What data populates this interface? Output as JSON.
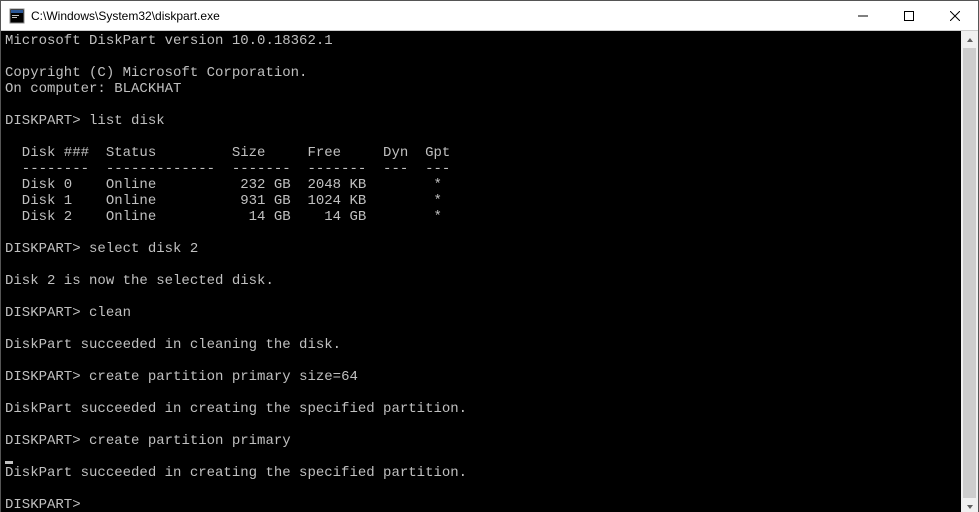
{
  "window": {
    "title": "C:\\Windows\\System32\\diskpart.exe"
  },
  "console": {
    "version_line": "Microsoft DiskPart version 10.0.18362.1",
    "copyright": "Copyright (C) Microsoft Corporation.",
    "computer_line": "On computer: BLACKHAT",
    "prompt": "DISKPART>",
    "cmd_list": "list disk",
    "header": "  Disk ###  Status         Size     Free     Dyn  Gpt",
    "divider": "  --------  -------------  -------  -------  ---  ---",
    "rows": {
      "r0": "  Disk 0    Online          232 GB  2048 KB        *",
      "r1": "  Disk 1    Online          931 GB  1024 KB        *",
      "r2": "  Disk 2    Online           14 GB    14 GB        *"
    },
    "cmd_select": "select disk 2",
    "msg_selected": "Disk 2 is now the selected disk.",
    "cmd_clean": "clean",
    "msg_clean": "DiskPart succeeded in cleaning the disk.",
    "cmd_create1": "create partition primary size=64",
    "msg_create1": "DiskPart succeeded in creating the specified partition.",
    "cmd_create2": "create partition primary",
    "msg_create2": "DiskPart succeeded in creating the specified partition."
  },
  "disks": [
    {
      "id": "Disk 0",
      "status": "Online",
      "size": "232 GB",
      "free": "2048 KB",
      "dyn": "",
      "gpt": "*"
    },
    {
      "id": "Disk 1",
      "status": "Online",
      "size": "931 GB",
      "free": "1024 KB",
      "dyn": "",
      "gpt": "*"
    },
    {
      "id": "Disk 2",
      "status": "Online",
      "size": "14 GB",
      "free": "14 GB",
      "dyn": "",
      "gpt": "*"
    }
  ]
}
